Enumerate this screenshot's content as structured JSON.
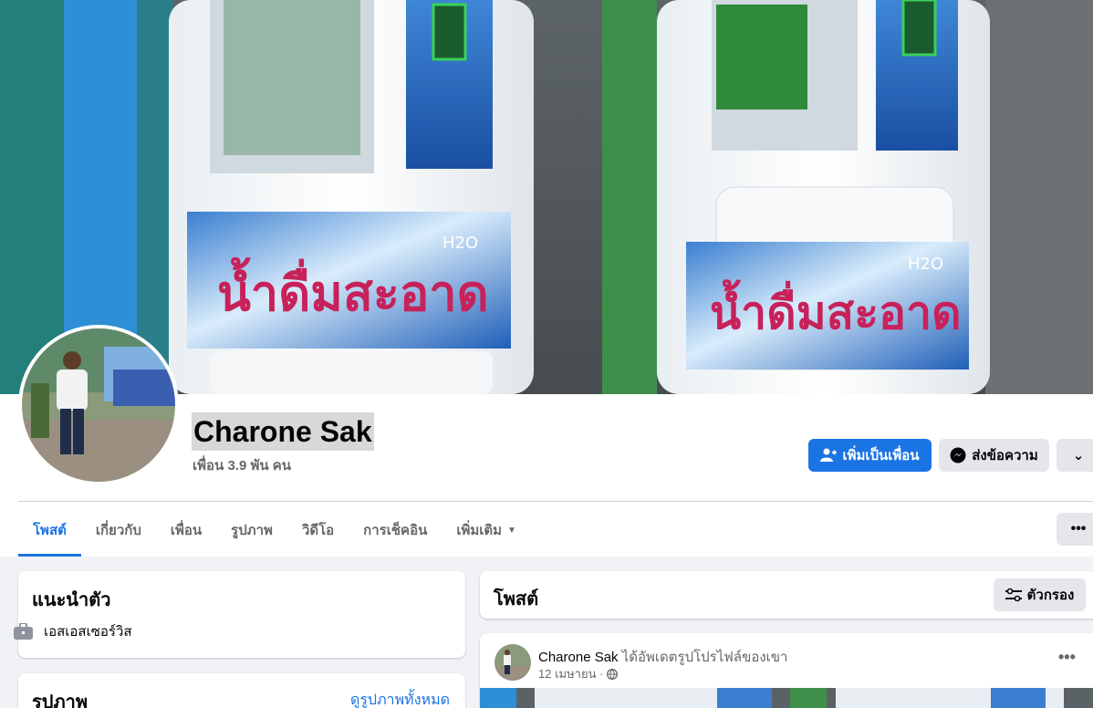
{
  "profile": {
    "name": "Charone Sak",
    "friends_count": "เพื่อน 3.9 พัน คน"
  },
  "cover": {
    "sign_text_left": "น้ำดื่มสะอาด",
    "sign_text_right": "น้ำดื่มสะอาด",
    "h2o_label": "H2O"
  },
  "actions": {
    "add_friend": "เพิ่มเป็นเพื่อน",
    "message": "ส่งข้อความ"
  },
  "tabs": [
    {
      "label": "โพสต์",
      "active": true
    },
    {
      "label": "เกี่ยวกับ",
      "active": false
    },
    {
      "label": "เพื่อน",
      "active": false
    },
    {
      "label": "รูปภาพ",
      "active": false
    },
    {
      "label": "วิดีโอ",
      "active": false
    },
    {
      "label": "การเช็คอิน",
      "active": false
    },
    {
      "label": "เพิ่มเติม",
      "active": false
    }
  ],
  "intro": {
    "title": "แนะนำตัว",
    "work": "เอสเอสเซอร์วิส"
  },
  "photos": {
    "title": "รูปภาพ",
    "see_all": "ดูรูปภาพทั้งหมด"
  },
  "posts": {
    "title": "โพสต์",
    "filter": "ตัวกรอง"
  },
  "post": {
    "author": "Charone Sak",
    "action": "ได้อัพเดตรูปโปรไฟล์ของเขา",
    "date": "12 เมษายน ·"
  },
  "colors": {
    "accent": "#1b74e4",
    "page_bg": "#f0f2f5"
  }
}
